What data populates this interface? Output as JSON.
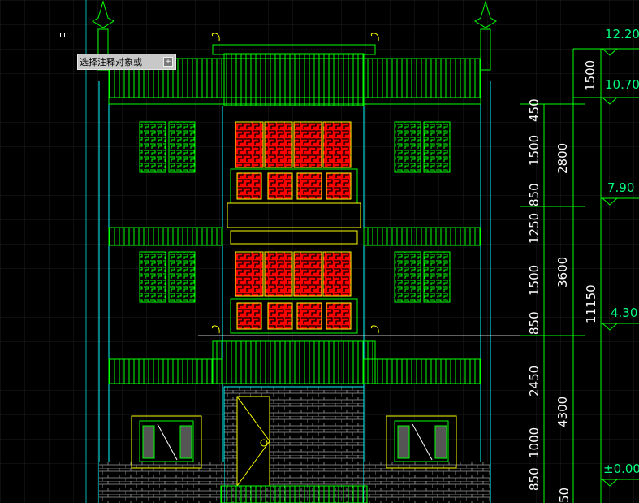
{
  "tooltip": {
    "text": "选择注释对象或",
    "expand_icon": "expand-icon"
  },
  "levels": [
    {
      "label": "12.20"
    },
    {
      "label": "10.70"
    },
    {
      "label": "7.90"
    },
    {
      "label": "4.30"
    },
    {
      "label": "±0.00"
    }
  ],
  "dims_inner": [
    {
      "label": "450"
    },
    {
      "label": "1500"
    },
    {
      "label": "850"
    },
    {
      "label": "1250"
    },
    {
      "label": "1500"
    },
    {
      "label": "850"
    },
    {
      "label": "2450"
    },
    {
      "label": "1000"
    },
    {
      "label": "850"
    },
    {
      "label": "50"
    }
  ],
  "dims_mid": [
    {
      "label": "2800"
    },
    {
      "label": "3600"
    },
    {
      "label": "4300"
    }
  ],
  "dims_outer": [
    {
      "label": "11150"
    }
  ],
  "dims_top": [
    {
      "label": "1500"
    }
  ],
  "colors": {
    "green": "#00ff00",
    "cyan": "#00ffff",
    "yellow": "#ffff00",
    "red": "#ff0000",
    "grid": "#1c1c1c"
  }
}
